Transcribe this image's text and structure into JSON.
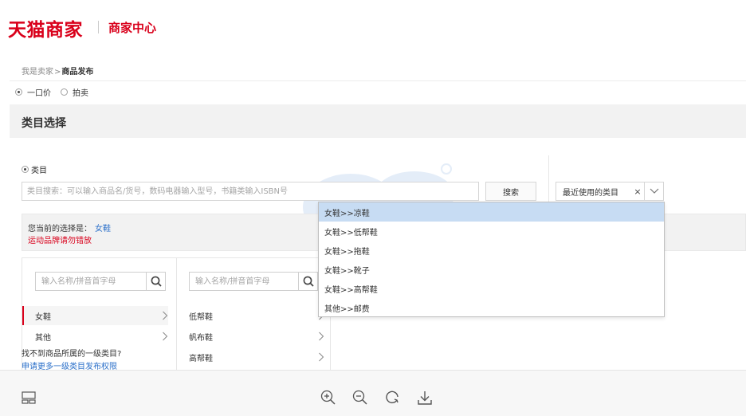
{
  "header": {
    "logo_text": "天猫商家",
    "logo_sub": "商家中心"
  },
  "breadcrumb": {
    "root": "我是卖家",
    "separator": ">",
    "current": "商品发布"
  },
  "sale_type": {
    "options": [
      {
        "label": "一口价",
        "checked": true
      },
      {
        "label": "拍卖",
        "checked": false
      }
    ]
  },
  "section": {
    "title": "类目选择"
  },
  "category": {
    "radio_label": "类目",
    "search_placeholder": "类目搜索：可以输入商品名/货号，数码电器输入型号，书籍类输入ISBN号",
    "search_button": "搜索",
    "recent_label": "最近使用的类目",
    "recent_clear": "×",
    "current_prefix": "您当前的选择是：",
    "current_value": "女鞋",
    "warning": "运动品牌请勿错放",
    "col1": {
      "search_placeholder": "输入名称/拼音首字母",
      "items": [
        {
          "label": "女鞋",
          "active": true
        },
        {
          "label": "其他",
          "active": false
        }
      ]
    },
    "col2": {
      "search_placeholder": "输入名称/拼音首字母",
      "items": [
        {
          "label": "低帮鞋"
        },
        {
          "label": "帆布鞋"
        },
        {
          "label": "高帮鞋"
        }
      ]
    },
    "not_found": "找不到商品所属的一级类目?",
    "request_link": "申请更多一级类目发布权限"
  },
  "recent_dropdown": {
    "items": [
      {
        "label": "女鞋>>凉鞋",
        "highlighted": true
      },
      {
        "label": "女鞋>>低帮鞋",
        "highlighted": false
      },
      {
        "label": "女鞋>>拖鞋",
        "highlighted": false
      },
      {
        "label": "女鞋>>靴子",
        "highlighted": false
      },
      {
        "label": "女鞋>>高帮鞋",
        "highlighted": false
      },
      {
        "label": "其他>>邮费",
        "highlighted": false
      }
    ]
  },
  "toolbar": {
    "icons": [
      "layout-icon",
      "zoom-in-icon",
      "zoom-out-icon",
      "rotate-icon",
      "download-icon"
    ]
  },
  "colors": {
    "brand_red": "#d9001b",
    "link_blue": "#2a6fc9",
    "highlight": "#c7dcf3"
  }
}
